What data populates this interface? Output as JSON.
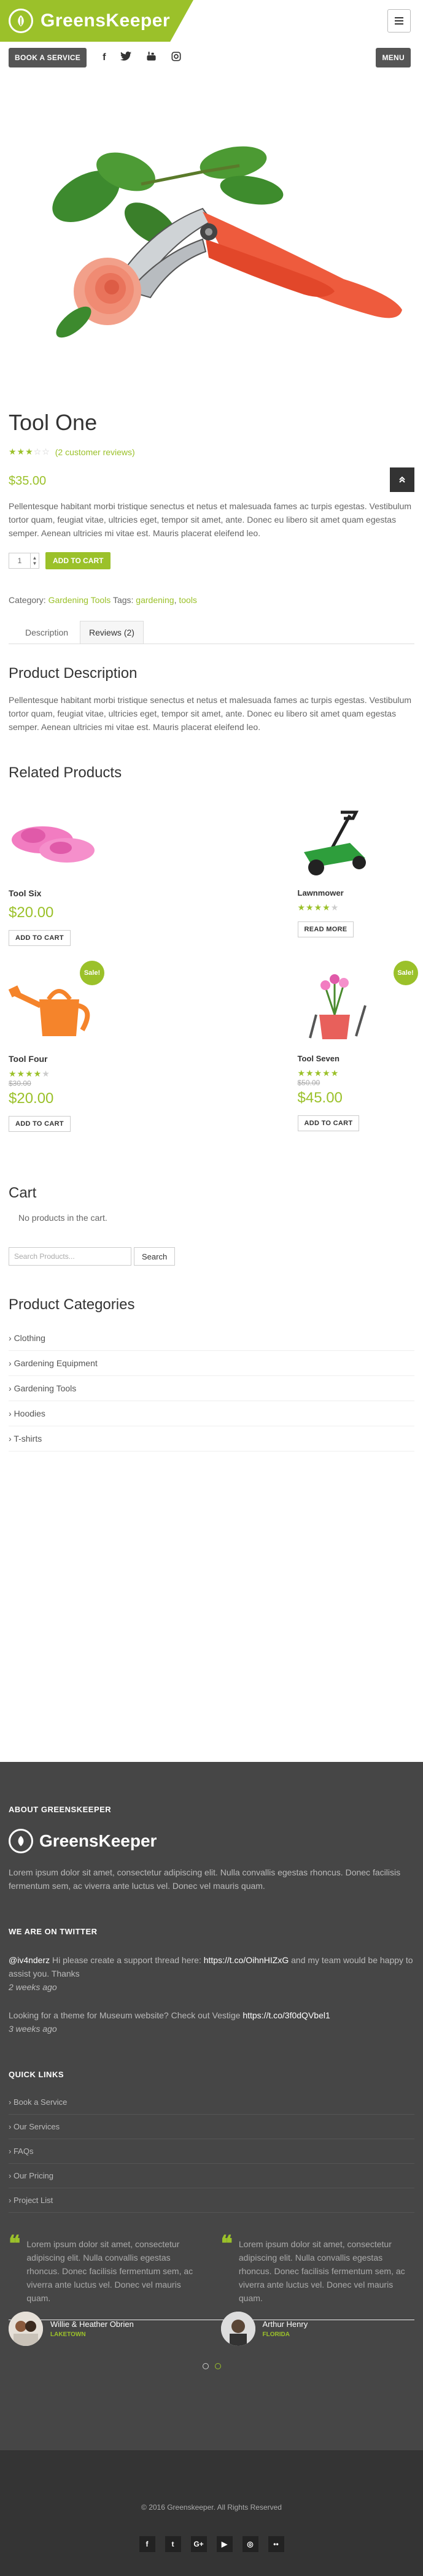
{
  "header": {
    "logo_text": "GreensKeeper",
    "book_label": "BOOK A SERVICE",
    "menu_label": "MENU",
    "social_icons": [
      "facebook-icon",
      "twitter-icon",
      "youtube-icon",
      "instagram-icon"
    ],
    "accent": "#9bc12a"
  },
  "product": {
    "title": "Tool One",
    "reviews_link": "(2 customer reviews)",
    "rating": 3,
    "rating_max": 5,
    "price": "$35.00",
    "short_description": "Pellentesque habitant morbi tristique senectus et netus et malesuada fames ac turpis egestas. Vestibulum tortor quam, feugiat vitae, ultricies eget, tempor sit amet, ante. Donec eu libero sit amet quam egestas semper. Aenean ultricies mi vitae est. Mauris placerat eleifend leo.",
    "quantity": "1",
    "add_to_cart": "ADD TO CART",
    "category_label": "Category:",
    "category": "Gardening Tools",
    "tags_label": "Tags:",
    "tag1": "gardening",
    "tag_sep": ",",
    "tag2": "tools"
  },
  "tabs": {
    "description": "Description",
    "reviews": "Reviews (2)"
  },
  "description": {
    "heading": "Product Description",
    "text": "Pellentesque habitant morbi tristique senectus et netus et malesuada fames ac turpis egestas. Vestibulum tortor quam, feugiat vitae, ultricies eget, tempor sit amet, ante. Donec eu libero sit amet quam egestas semper. Aenean ultricies mi vitae est. Mauris placerat eleifend leo."
  },
  "related": {
    "heading": "Related Products",
    "products": [
      {
        "name": "Tool Six",
        "price": "$20.00",
        "button": "ADD TO CART"
      },
      {
        "name": "Lawnmower",
        "rating": 4.5,
        "button": "READ MORE"
      },
      {
        "name": "Tool Four",
        "rating": 4,
        "old_price": "$30.00",
        "price": "$20.00",
        "button": "ADD TO CART",
        "sale": "Sale!"
      },
      {
        "name": "Tool Seven",
        "rating": 5,
        "old_price": "$50.00",
        "price": "$45.00",
        "button": "ADD TO CART",
        "sale": "Sale!"
      }
    ]
  },
  "cart": {
    "heading": "Cart",
    "empty": "No products in the cart."
  },
  "search": {
    "placeholder": "Search Products...",
    "button": "Search"
  },
  "categories": {
    "heading": "Product Categories",
    "items": [
      "Clothing",
      "Gardening Equipment",
      "Gardening Tools",
      "Hoodies",
      "T-shirts"
    ]
  },
  "footer": {
    "about_heading": "ABOUT GREENSKEEPER",
    "logo_text": "GreensKeeper",
    "about_text": "Lorem ipsum dolor sit amet, consectetur adipiscing elit. Nulla convallis egestas rhoncus. Donec facilisis fermentum sem, ac viverra ante luctus vel. Donec vel mauris quam.",
    "twitter_heading": "WE ARE ON TWITTER",
    "tweets": [
      {
        "handle": "@iv4nderz",
        "text": "Hi please create a support thread here:",
        "link": "https://t.co/OihnHIZxG",
        "text2": "and my team would be happy to assist you. Thanks",
        "time": "2 weeks ago"
      },
      {
        "text": "Looking for a theme for Museum website? Check out Vestige",
        "link": "https://t.co/3f0dQVbel1",
        "time": "3 weeks ago"
      }
    ],
    "quick_heading": "QUICK LINKS",
    "quick_links": [
      "Book a Service",
      "Our Services",
      "FAQs",
      "Our Pricing",
      "Project List"
    ],
    "testimonials": [
      {
        "quote": "Lorem ipsum dolor sit amet, consectetur adipiscing elit. Nulla convallis egestas rhoncus. Donec facilisis fermentum sem, ac viverra ante luctus vel. Donec vel mauris quam.",
        "name": "Willie & Heather Obrien",
        "place": "LAKETOWN"
      },
      {
        "quote": "Lorem ipsum dolor sit amet, consectetur adipiscing elit. Nulla convallis egestas rhoncus. Donec facilisis fermentum sem, ac viverra ante luctus vel. Donec vel mauris quam.",
        "name": "Arthur Henry",
        "place": "FLORIDA"
      }
    ],
    "copyright": "© 2016 Greenskeeper. All Rights Reserved",
    "social_icons": [
      "facebook-icon",
      "twitter-icon",
      "google-plus-icon",
      "youtube-icon",
      "instagram-icon",
      "flickr-icon"
    ]
  }
}
